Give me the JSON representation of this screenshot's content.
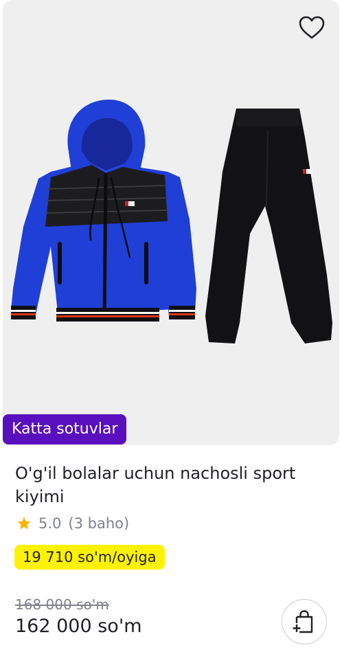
{
  "product": {
    "badge": "Katta sotuvlar",
    "title": "O'g'il bolalar uchun nachosli sport kiyimi",
    "rating": "5.0",
    "rating_count": "(3 baho)",
    "installment": "19 710 so'm/oyiga",
    "old_price": "168 000 so'm",
    "price": "162 000 so'm"
  },
  "colors": {
    "badge_bg": "#5a0fbf",
    "installment_bg": "#fff200",
    "star": "#f7b500",
    "jacket_blue": "#1f3fd6",
    "dark": "#111111"
  },
  "icons": {
    "favorite": "heart-icon",
    "rating": "star-icon",
    "cart": "add-to-cart-icon"
  }
}
